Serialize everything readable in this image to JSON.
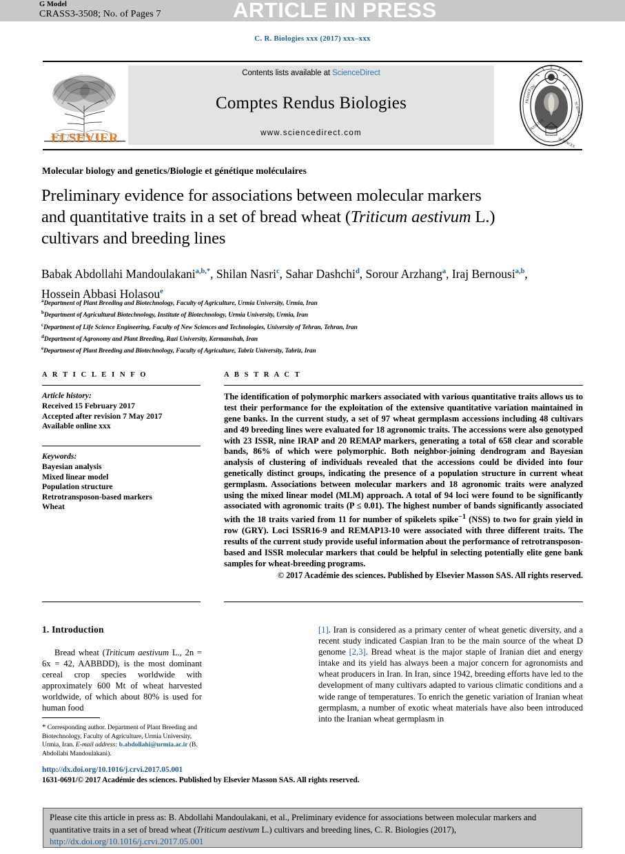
{
  "banner": {
    "g_model": "G Model",
    "article_id": "CRASS3-3508; No. of Pages 7",
    "status": "ARTICLE IN PRESS"
  },
  "journal_ref": "C. R. Biologies xxx (2017) xxx–xxx",
  "masthead": {
    "contents_prefix": "Contents lists available at ",
    "sciencedirect": "ScienceDirect",
    "journal_title": "Comptes Rendus Biologies",
    "url": "www.sciencedirect.com",
    "publisher": "ELSEVIER",
    "publisher_color": "#e87722",
    "link_color": "#2a7ab0"
  },
  "article": {
    "category": "Molecular biology and genetics/Biologie et génétique moléculaires",
    "title_line1": "Preliminary evidence for associations between molecular",
    "title_line2": "markers and quantitative traits in a set of bread wheat",
    "title_line3_pre": "(",
    "title_species": "Triticum aestivum",
    "title_line3_post": " L.) cultivars and breeding lines"
  },
  "authors": [
    {
      "name": "Babak Abdollahi Mandoulakani",
      "marks": "a,b,*"
    },
    {
      "name": "Shilan Nasri",
      "marks": "c"
    },
    {
      "name": "Sahar Dashchi",
      "marks": "d"
    },
    {
      "name": "Sorour Arzhang",
      "marks": "a"
    },
    {
      "name": "Iraj Bernousi",
      "marks": "a,b"
    },
    {
      "name": "Hossein Abbasi Holasou",
      "marks": "e"
    }
  ],
  "affiliations": [
    {
      "mark": "a",
      "text": "Department of Plant Breeding and Biotechnology, Faculty of Agriculture, Urmia University, Urmia, Iran"
    },
    {
      "mark": "b",
      "text": "Department of Agricultural Biotechnology, Institute of Biotechnology, Urmia University, Urmia, Iran"
    },
    {
      "mark": "c",
      "text": "Department of Life Science Engineering, Faculty of New Sciences and Technologies, University of Tehran, Tehran, Iran"
    },
    {
      "mark": "d",
      "text": "Department of Agronomy and Plant Breeding, Razi University, Kermanshah, Iran"
    },
    {
      "mark": "e",
      "text": "Department of Plant Breeding and Biotechnology, Faculty of Agriculture, Tabriz University, Tabriz, Iran"
    }
  ],
  "article_info": {
    "label": "A R T I C L E   I N F O",
    "history_label": "Article history:",
    "received": "Received 15 February 2017",
    "accepted": "Accepted after revision 7 May 2017",
    "available": "Available online xxx",
    "keywords_label": "Keywords:",
    "keywords": [
      "Bayesian analysis",
      "Mixed linear model",
      "Population structure",
      "Retrotransposon-based markers",
      "Wheat"
    ]
  },
  "abstract": {
    "label": "A B S T R A C T",
    "text": "The identification of polymorphic markers associated with various quantitative traits allows us to test their performance for the exploitation of the extensive quantitative variation maintained in gene banks. In the current study, a set of 97 wheat germplasm accessions including 48 cultivars and 49 breeding lines were evaluated for 18 agronomic traits. The accessions were also genotyped with 23 ISSR, nine IRAP and 20 REMAP markers, generating a total of 658 clear and scorable bands, 86% of which were polymorphic. Both neighbor-joining dendrogram and Bayesian analysis of clustering of individuals revealed that the accessions could be divided into four genetically distinct groups, indicating the presence of a population structure in current wheat germplasm. Associations between molecular markers and 18 agronomic traits were analyzed using the mixed linear model (MLM) approach. A total of 94 loci were found to be significantly associated with agronomic traits (P ≤ 0.01). The highest number of bands significantly associated with the 18 traits varied from 11 for number of spikelets spike",
    "superscript": "−1",
    "text_cont": " (NSS) to two for grain yield in row (GRY). Loci ISSR16-9 and REMAP13-10 were associated with three different traits. The results of the current study provide useful information about the performance of retrotransposon-based and ISSR molecular markers that could be helpful in selecting potentially elite gene bank samples for wheat-breeding programs.",
    "copyright": "© 2017 Académie des sciences. Published by Elsevier Masson SAS. All rights reserved."
  },
  "intro": {
    "heading": "1. Introduction",
    "left_pre": "Bread wheat (",
    "left_species": "Triticum aestivum",
    "left_post": " L., 2n = 6x = 42, AABBDD), is the most dominant cereal crop species worldwide with approximately 600 Mt of wheat harvested worldwide, of which about 80% is used for human food",
    "right_ref1": "[1]",
    "right_part1": ". Iran is considered as a primary center of wheat genetic diversity, and a recent study indicated Caspian Iran to be the main source of the wheat D genome ",
    "right_ref2": "[2,3]",
    "right_part2": ". Bread wheat is the major staple of Iranian diet and energy intake and its yield has always been a major concern for agronomists and wheat producers in Iran. In Iran, since 1942, breeding efforts have led to the development of many cultivars adapted to various climatic conditions and a wide range of temperatures. To enrich the genetic variation of Iranian wheat germplasm, a number of exotic wheat materials have also been introduced into the Iranian wheat germplasm in"
  },
  "footnote": {
    "star": "*",
    "text": " Corresponding author. Department of Plant Breeding and Biotechnology, Faculty of Agriculture, Urmia University, Urmia, Iran.",
    "email_label": "E-mail address:",
    "email": "b.abdollahi@urmia.ac.ir",
    "email_suffix": " (B. Abdollahi Mandoulakani)."
  },
  "bottom": {
    "doi": "http://dx.doi.org/10.1016/j.crvi.2017.05.001",
    "issn": "1631-0691/© 2017 Académie des sciences. Published by Elsevier Masson SAS. All rights reserved."
  },
  "cite_box": {
    "part1": "Please cite this article in press as: B. Abdollahi Mandoulakani, et al., Preliminary evidence for associations between molecular markers and quantitative traits in a set of bread wheat (",
    "species": "Triticum aestivum",
    "part2": " L.) cultivars and breeding lines, C. R. Biologies (2017), ",
    "doi": "http://dx.doi.org/10.1016/j.crvi.2017.05.001"
  }
}
